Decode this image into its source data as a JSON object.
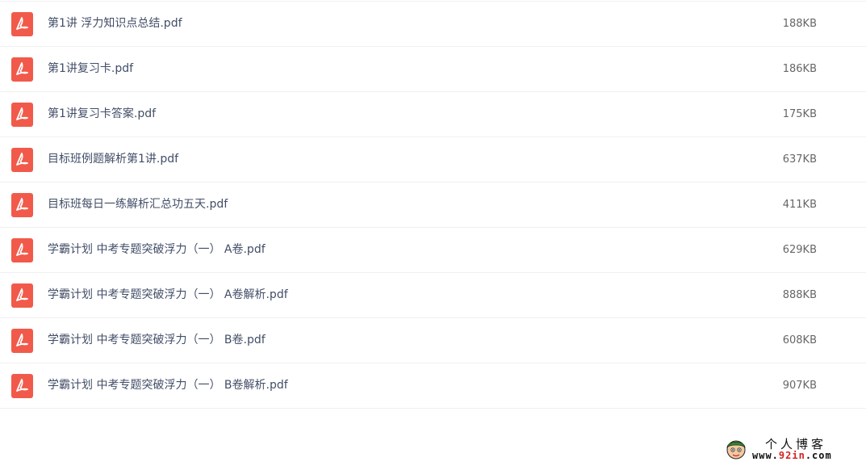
{
  "files": [
    {
      "name": "第1讲 浮力知识点总结.pdf",
      "size": "188KB"
    },
    {
      "name": "第1讲复习卡.pdf",
      "size": "186KB"
    },
    {
      "name": "第1讲复习卡答案.pdf",
      "size": "175KB"
    },
    {
      "name": "目标班例题解析第1讲.pdf",
      "size": "637KB"
    },
    {
      "name": "目标班每日一练解析汇总功五天.pdf",
      "size": "411KB"
    },
    {
      "name": "学霸计划 中考专题突破浮力（一） A卷.pdf",
      "size": "629KB"
    },
    {
      "name": "学霸计划 中考专题突破浮力（一） A卷解析.pdf",
      "size": "888KB"
    },
    {
      "name": "学霸计划 中考专题突破浮力（一） B卷.pdf",
      "size": "608KB"
    },
    {
      "name": "学霸计划 中考专题突破浮力（一） B卷解析.pdf",
      "size": "907KB"
    }
  ],
  "file_icon": "pdf-icon",
  "colors": {
    "pdf_icon": "#f15a4a",
    "file_name": "#424e67",
    "file_size": "#666666",
    "row_border": "#f0f0f0",
    "watermark_accent": "#d22222"
  },
  "watermark": {
    "title": "个人博客",
    "url_prefix": "www.",
    "url_accent": "92in",
    "url_suffix": ".com",
    "icon": "cartoon-face-logo"
  }
}
